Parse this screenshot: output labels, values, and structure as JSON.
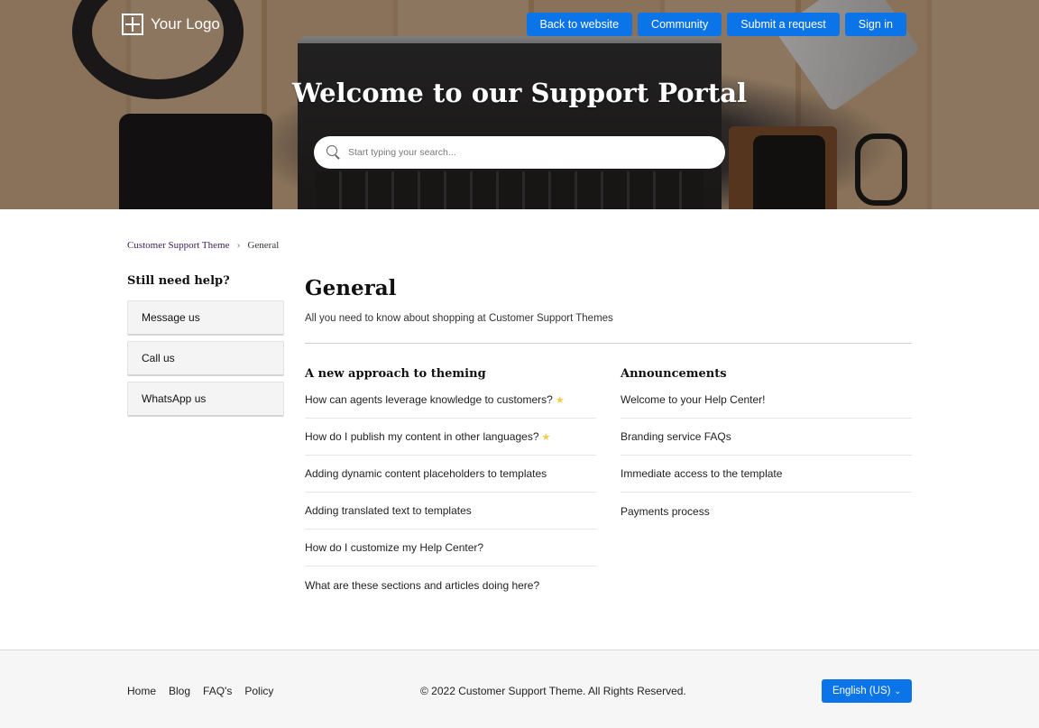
{
  "header": {
    "logo_text": "Your Logo",
    "nav": [
      "Back to website",
      "Community",
      "Submit a request",
      "Sign in"
    ],
    "title": "Welcome to our Support Portal",
    "search": {
      "placeholder": "Start typing your search..."
    }
  },
  "breadcrumb": {
    "items": [
      "Customer Support Theme",
      "General"
    ]
  },
  "sidebar": {
    "heading": "Still need help?",
    "buttons": [
      "Message us",
      "Call us",
      "WhatsApp us"
    ]
  },
  "main": {
    "title": "General",
    "description": "All you need to know about shopping at Customer Support Themes",
    "sections": [
      {
        "title": "A new approach to theming",
        "articles": [
          "How can agents leverage knowledge to customers?",
          "How do I publish my content in other languages?",
          "Adding dynamic content placeholders to templates",
          "Adding translated text to templates",
          "How do I customize my Help Center?",
          "What are these sections and articles doing here?"
        ]
      },
      {
        "title": "Announcements",
        "articles": [
          "Welcome to your Help Center!",
          "Branding service FAQs",
          "Immediate access to the template",
          "Payments process"
        ]
      }
    ]
  },
  "footer": {
    "links": [
      "Home",
      "Blog",
      "FAQ's",
      "Policy"
    ],
    "copyright": "© 2022 Customer Support Theme. All Rights Reserved.",
    "language": "English (US)"
  },
  "icons": {
    "star": "star-icon",
    "search": "search-icon",
    "logo": "logo-icon"
  },
  "colors": {
    "accent": "#0b74e8",
    "star": "#f2c94c",
    "breadcrumb_link": "#3c1d5a"
  }
}
